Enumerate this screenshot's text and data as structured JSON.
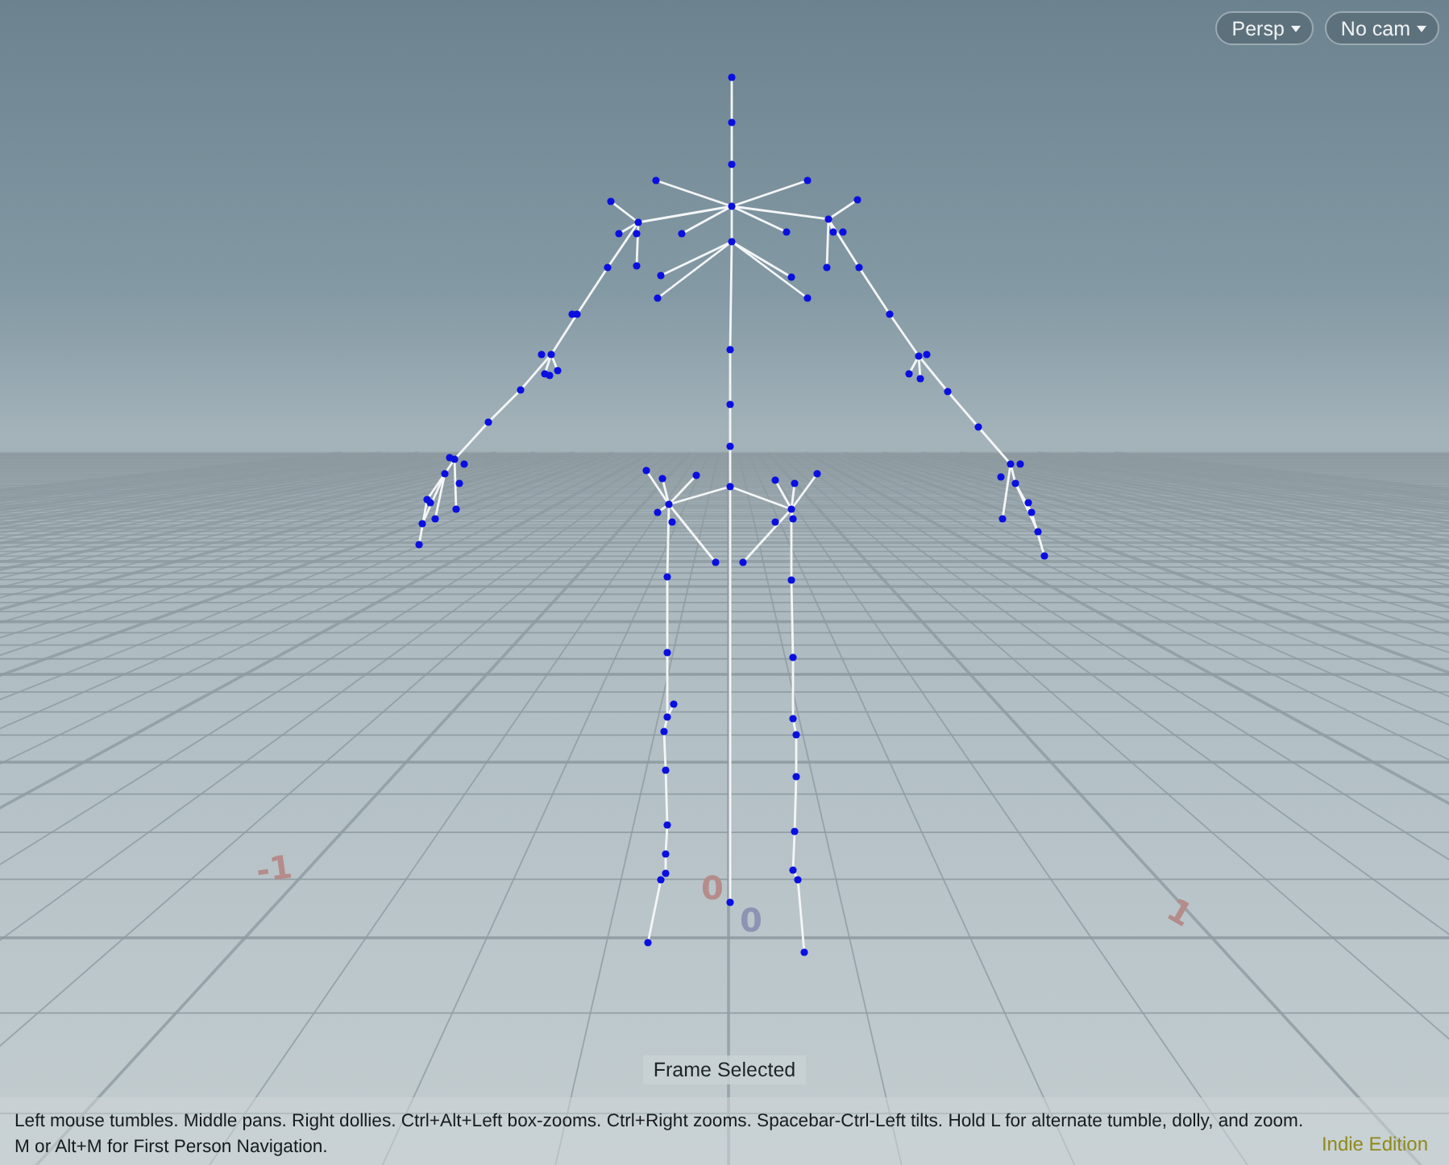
{
  "viewport": {
    "camera_buttons": [
      {
        "label": "Persp"
      },
      {
        "label": "No cam"
      }
    ],
    "grid_labels": [
      {
        "text": "-1",
        "color": "#b58c8a"
      },
      {
        "text": "0",
        "color": "#b58c8a"
      },
      {
        "text": "0",
        "color": "#8c93b3"
      },
      {
        "text": "1",
        "color": "#b58c8a"
      }
    ],
    "status": "Frame Selected",
    "help_text": "Left mouse tumbles. Middle pans. Right dollies. Ctrl+Alt+Left box-zooms. Ctrl+Right zooms. Spacebar-Ctrl-Left tilts. Hold L for alternate tumble, dolly, and zoom. M or Alt+M for First Person Navigation.",
    "edition": "Indie Edition"
  }
}
